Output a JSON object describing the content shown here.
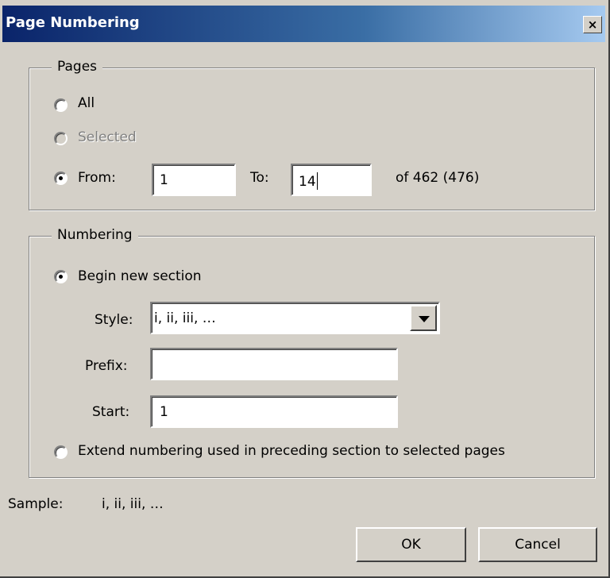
{
  "window": {
    "title": "Page Numbering",
    "close_icon": "×"
  },
  "pages": {
    "legend": "Pages",
    "all_label": "All",
    "selected_label": "Selected",
    "from_label": "From:",
    "from_value": "1",
    "to_label": "To:",
    "to_value": "14",
    "of_label": "of 462 (476)",
    "selected_option": "from"
  },
  "numbering": {
    "legend": "Numbering",
    "begin_label": "Begin new section",
    "style_label": "Style:",
    "style_value": "i, ii, iii, …",
    "prefix_label": "Prefix:",
    "prefix_value": "",
    "start_label": "Start:",
    "start_value": "1",
    "extend_label": "Extend numbering used in preceding section to selected pages",
    "selected_option": "begin"
  },
  "sample": {
    "label": "Sample:",
    "value": "i, ii, iii, …"
  },
  "buttons": {
    "ok": "OK",
    "cancel": "Cancel"
  }
}
